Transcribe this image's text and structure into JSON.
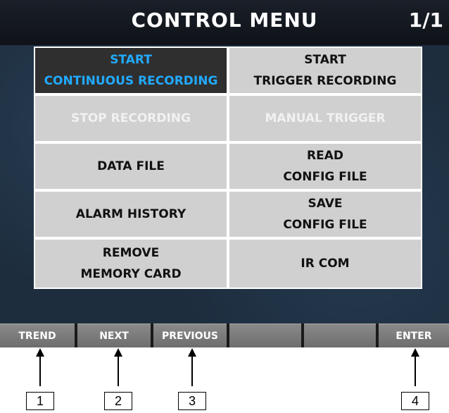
{
  "header": {
    "title": "CONTROL MENU",
    "page": "1/1"
  },
  "menu": {
    "items": [
      {
        "label": "START\nCONTINUOUS RECORDING",
        "state": "selected"
      },
      {
        "label": "START\nTRIGGER RECORDING",
        "state": "normal"
      },
      {
        "label": "STOP RECORDING",
        "state": "disabled"
      },
      {
        "label": "MANUAL TRIGGER",
        "state": "disabled"
      },
      {
        "label": "DATA FILE",
        "state": "normal"
      },
      {
        "label": "READ\nCONFIG FILE",
        "state": "normal"
      },
      {
        "label": "ALARM HISTORY",
        "state": "normal"
      },
      {
        "label": "SAVE\nCONFIG FILE",
        "state": "normal"
      },
      {
        "label": "REMOVE\nMEMORY CARD",
        "state": "normal"
      },
      {
        "label": "IR COM",
        "state": "normal"
      }
    ]
  },
  "fkeys": [
    "TREND",
    "NEXT",
    "PREVIOUS",
    "",
    "",
    "ENTER"
  ],
  "callouts": [
    "1",
    "2",
    "3",
    "4"
  ],
  "colors": {
    "selected_text": "#22aaff",
    "cell_bg": "#d0d0d0",
    "screen_bg": "#1d2d3e"
  }
}
